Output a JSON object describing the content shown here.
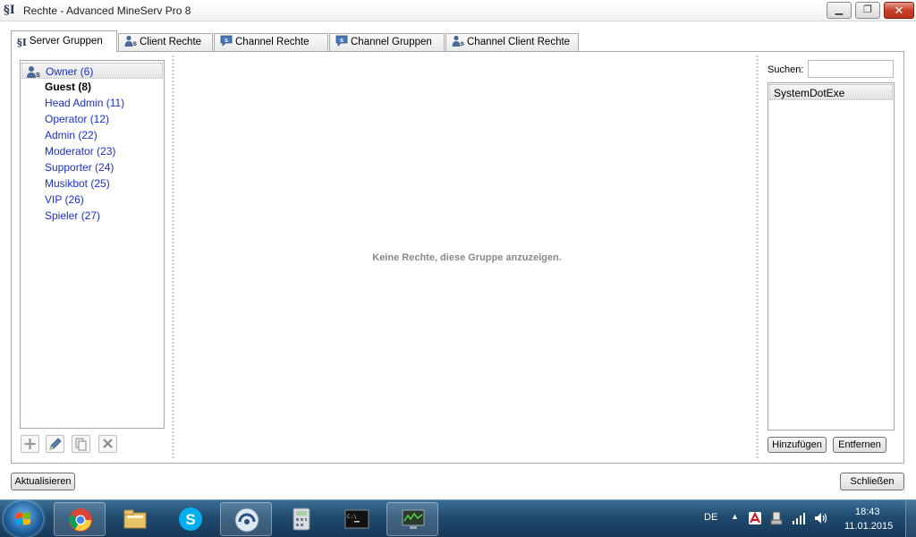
{
  "window": {
    "title": "Rechte - Advanced MineServ Pro 8",
    "icon_glyph": "§I",
    "minimize": "▁",
    "maximize": "❐",
    "close": "✕"
  },
  "tabs": [
    {
      "label": "Server Gruppen",
      "active": true
    },
    {
      "label": "Client Rechte"
    },
    {
      "label": "Channel Rechte"
    },
    {
      "label": "Channel Gruppen"
    },
    {
      "label": "Channel Client Rechte"
    }
  ],
  "groups": [
    {
      "label": "Owner (6)",
      "selected": true,
      "icon": "user-group-icon"
    },
    {
      "label": "Guest (8)",
      "bold": true
    },
    {
      "label": "Head Admin (11)"
    },
    {
      "label": "Operator (12)"
    },
    {
      "label": "Admin (22)"
    },
    {
      "label": "Moderator (23)"
    },
    {
      "label": "Supporter (24)"
    },
    {
      "label": "Musikbot (25)"
    },
    {
      "label": "VIP (26)"
    },
    {
      "label": "Spieler (27)"
    }
  ],
  "group_tools": [
    "add-icon",
    "edit-icon",
    "copy-icon",
    "delete-icon"
  ],
  "main": {
    "empty_message": "Keine Rechte, diese Gruppe anzuzeigen."
  },
  "search": {
    "label": "Suchen:",
    "value": ""
  },
  "users": [
    "SystemDotExe"
  ],
  "buttons": {
    "add": "Hinzufügen",
    "remove": "Entfernen",
    "refresh": "Aktualisieren",
    "close": "Schließen"
  },
  "taskbar": {
    "apps": [
      "chrome-icon",
      "file-explorer-icon",
      "skype-icon",
      "teamspeak-icon",
      "calculator-icon",
      "command-prompt-icon",
      "server-app-icon"
    ],
    "language": "DE",
    "time": "18:43",
    "date": "11.01.2015"
  },
  "colors": {
    "group_link": "#1a2fd0",
    "taskbar": "#1f4a6e"
  }
}
